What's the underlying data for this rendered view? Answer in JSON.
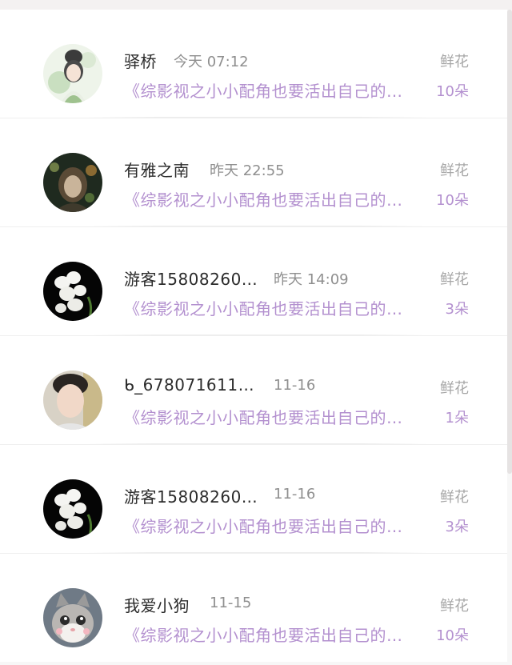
{
  "items": [
    {
      "name": "驿桥",
      "time": "今天 07:12",
      "desc": "《综影视之小小配角也要活出自己的…",
      "gift": "鲜花",
      "count": "10朵",
      "avatar": "illustrated-woman-avatar"
    },
    {
      "name": "有雅之南",
      "time": "昨天 22:55",
      "desc": "《综影视之小小配角也要活出自己的…",
      "gift": "鲜花",
      "count": "10朵",
      "avatar": "fantasy-portrait-avatar"
    },
    {
      "name": "游客15808260…",
      "time": "昨天 14:09",
      "desc": "《综影视之小小配角也要活出自己的…",
      "gift": "鲜花",
      "count": "3朵",
      "avatar": "orchid-flower-avatar"
    },
    {
      "name": "ᑲ_678071611…",
      "time": "11-16",
      "desc": "《综影视之小小配角也要活出自己的…",
      "gift": "鲜花",
      "count": "1朵",
      "avatar": "user-photo-avatar"
    },
    {
      "name": "游客15808260…",
      "time": "11-16",
      "desc": "《综影视之小小配角也要活出自己的…",
      "gift": "鲜花",
      "count": "3朵",
      "avatar": "orchid-flower-avatar"
    },
    {
      "name": "我爱小狗",
      "time": "11-15",
      "desc": "《综影视之小小配角也要活出自己的…",
      "gift": "鲜花",
      "count": "10朵",
      "avatar": "cat-avatar"
    }
  ]
}
